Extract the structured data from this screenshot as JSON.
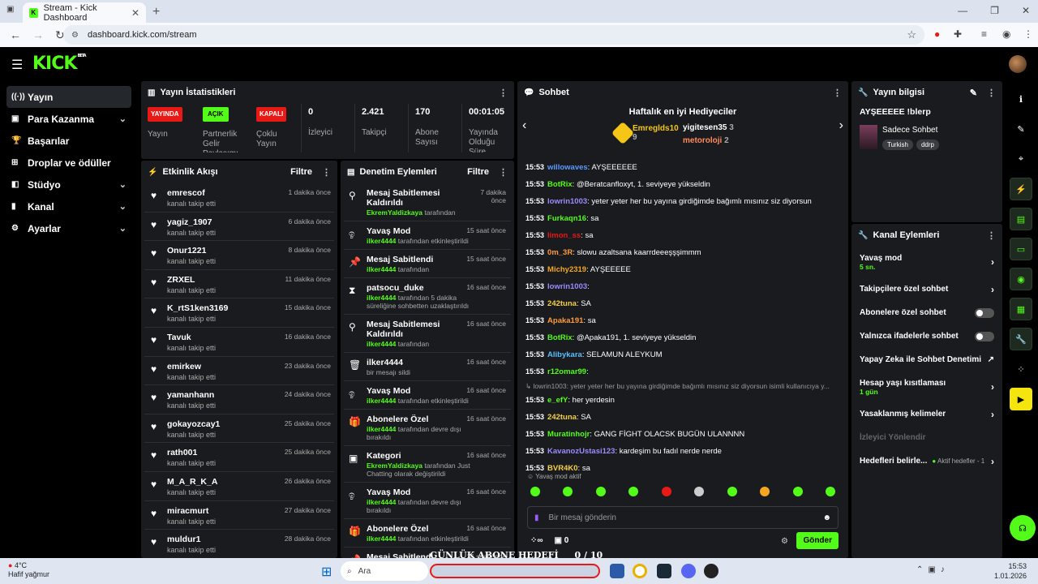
{
  "browser": {
    "tab_title": "Stream - Kick Dashboard",
    "url": "dashboard.kick.com/stream"
  },
  "brand": {
    "logo": "KICK",
    "beta": "BETA",
    "accent": "#53fc18"
  },
  "sidebar": {
    "items": [
      {
        "label": "Yayın",
        "icon": "broadcast-icon"
      },
      {
        "label": "Para Kazanma",
        "icon": "money-icon"
      },
      {
        "label": "Başarılar",
        "icon": "trophy-icon"
      },
      {
        "label": "Droplar ve ödüller",
        "icon": "gift-icon"
      },
      {
        "label": "Stüdyo",
        "icon": "studio-icon"
      },
      {
        "label": "Kanal",
        "icon": "channel-icon"
      },
      {
        "label": "Ayarlar",
        "icon": "gear-icon"
      }
    ]
  },
  "stats": {
    "title": "Yayın İstatistikleri",
    "live_badge": "YAYINDA",
    "live_label": "Yayın",
    "partner_badge": "AÇIK",
    "partner_label": "Partnerlik Gelir Paylaşımı",
    "multi_badge": "KAPALI",
    "multi_label": "Çoklu Yayın",
    "viewers_value": "0",
    "viewers_label": "İzleyici",
    "followers_value": "2.421",
    "followers_label": "Takipçi",
    "subs_value": "170",
    "subs_label": "Abone Sayısı",
    "uptime_value": "00:01:05",
    "uptime_label": "Yayında Olduğu Süre"
  },
  "activity": {
    "title": "Etkinlik Akışı",
    "filter": "Filtre",
    "rows": [
      {
        "name": "emrescof",
        "sub": "kanalı takip etti",
        "time": "1 dakika önce"
      },
      {
        "name": "yagiz_1907",
        "sub": "kanalı takip etti",
        "time": "6 dakika önce"
      },
      {
        "name": "Onur1221",
        "sub": "kanalı takip etti",
        "time": "8 dakika önce"
      },
      {
        "name": "ZRXEL",
        "sub": "kanalı takip etti",
        "time": "11 dakika önce"
      },
      {
        "name": "K_rtS1ken3169",
        "sub": "kanalı takip etti",
        "time": "15 dakika önce"
      },
      {
        "name": "Tavuk",
        "sub": "kanalı takip etti",
        "time": "16 dakika önce"
      },
      {
        "name": "emirkew",
        "sub": "kanalı takip etti",
        "time": "23 dakika önce"
      },
      {
        "name": "yamanhann",
        "sub": "kanalı takip etti",
        "time": "24 dakika önce"
      },
      {
        "name": "gokayozcay1",
        "sub": "kanalı takip etti",
        "time": "25 dakika önce"
      },
      {
        "name": "rath001",
        "sub": "kanalı takip etti",
        "time": "25 dakika önce"
      },
      {
        "name": "M_A_R_K_A",
        "sub": "kanalı takip etti",
        "time": "26 dakika önce"
      },
      {
        "name": "miracmurt",
        "sub": "kanalı takip etti",
        "time": "27 dakika önce"
      },
      {
        "name": "muldur1",
        "sub": "kanalı takip etti",
        "time": "28 dakika önce"
      }
    ]
  },
  "moderation": {
    "title": "Denetim Eylemleri",
    "filter": "Filtre",
    "rows": [
      {
        "name": "Mesaj Sabitlemesi Kaldırıldı",
        "user": "EkremYaldizkaya",
        "sub": " tarafından",
        "time": "7 dakika önce",
        "icon": "unpin-icon"
      },
      {
        "name": "Yavaş Mod",
        "user": "ilker4444",
        "sub": " tarafından etkinleştirildi",
        "time": "15 saat önce",
        "icon": "snail-icon"
      },
      {
        "name": "Mesaj Sabitlendi",
        "user": "ilker4444",
        "sub": " tarafından",
        "time": "15 saat önce",
        "icon": "pin-icon"
      },
      {
        "name": "patsocu_duke",
        "user": "ilker4444",
        "sub": " tarafından 5 dakika süreliğine sohbetten uzaklaştırıldı",
        "time": "16 saat önce",
        "icon": "hourglass-icon"
      },
      {
        "name": "Mesaj Sabitlemesi Kaldırıldı",
        "user": "ilker4444",
        "sub": " tarafından",
        "time": "16 saat önce",
        "icon": "unpin-icon"
      },
      {
        "name": "ilker4444",
        "user": "",
        "sub": "bir mesajı sildi",
        "time": "16 saat önce",
        "icon": "trash-icon"
      },
      {
        "name": "Yavaş Mod",
        "user": "ilker4444",
        "sub": " tarafından etkinleştirildi",
        "time": "16 saat önce",
        "icon": "snail-icon"
      },
      {
        "name": "Abonelere Özel",
        "user": "ilker4444",
        "sub": " tarafından devre dışı bırakıldı",
        "time": "16 saat önce",
        "icon": "gift-icon"
      },
      {
        "name": "Kategori",
        "user": "EkremYaldizkaya",
        "sub": " tarafından Just Chatting olarak değiştirildi",
        "time": "16 saat önce",
        "icon": "category-icon"
      },
      {
        "name": "Yavaş Mod",
        "user": "ilker4444",
        "sub": " tarafından devre dışı bırakıldı",
        "time": "16 saat önce",
        "icon": "snail-icon"
      },
      {
        "name": "Abonelere Özel",
        "user": "ilker4444",
        "sub": " tarafından etkinleştirildi",
        "time": "16 saat önce",
        "icon": "gift-icon"
      },
      {
        "name": "Mesaj Sabitlendi",
        "user": "",
        "sub": "",
        "time": "16 saat önce",
        "icon": "pin-icon"
      }
    ]
  },
  "chat": {
    "title": "Sohbet",
    "gifters_title": "Haftalık en iyi Hediyeciler",
    "gifter1": "Emreglds10",
    "gifter1_count": "9",
    "gifter2": "yigitesen35",
    "gifter2_count": "3",
    "gifter3": "metoroloji",
    "gifter3_count": "2",
    "messages": [
      {
        "time": "15:53",
        "user": "willowaves",
        "color": "#5b9bff",
        "text": "AYŞEEEEEE"
      },
      {
        "time": "15:53",
        "user": "BotRix",
        "color": "#53fc18",
        "text": "@Beratcanfloxyt, 1. seviyeye yükseldin"
      },
      {
        "time": "15:53",
        "user": "lowrin1003",
        "color": "#9b8cff",
        "text": "yeter yeter her bu yayına girdiğimde bağımlı mısınız siz diyorsun"
      },
      {
        "time": "15:53",
        "user": "Furkaqn16",
        "color": "#53fc18",
        "text": "sa"
      },
      {
        "time": "15:53",
        "user": "limon_ss",
        "color": "#e91916",
        "text": "sa"
      },
      {
        "time": "15:53",
        "user": "0m_3R",
        "color": "#ff9b3b",
        "text": "slowu azaltsana kaarrdeeeşşşimmm"
      },
      {
        "time": "15:53",
        "user": "Michy2319",
        "color": "#f5a623",
        "text": "AYŞEEEEE"
      },
      {
        "time": "15:53",
        "user": "lowrin1003",
        "color": "#9b8cff",
        "text": ""
      },
      {
        "time": "15:53",
        "user": "242tuna",
        "color": "#f5d142",
        "text": "SA"
      },
      {
        "time": "15:53",
        "user": "Apaka191",
        "color": "#ff9b3b",
        "text": "sa"
      },
      {
        "time": "15:53",
        "user": "BotRix",
        "color": "#53fc18",
        "text": "@Apaka191, 1. seviyeye yükseldin"
      },
      {
        "time": "15:53",
        "user": "Alibykara",
        "color": "#5bc0ff",
        "text": "SELAMUN ALEYKUM"
      },
      {
        "time": "15:53",
        "user": "r12omar99",
        "color": "#53fc18",
        "text": ""
      },
      {
        "time": "",
        "user": "",
        "color": "#999",
        "text": "↳ lowrin1003: yeter yeter her bu yayına girdiğimde bağımlı mısınız siz diyorsun isimli kullanıcıya y..."
      },
      {
        "time": "15:53",
        "user": "e_efY",
        "color": "#53fc18",
        "text": "her yerdesin"
      },
      {
        "time": "15:53",
        "user": "242tuna",
        "color": "#f5d142",
        "text": "SA"
      },
      {
        "time": "15:53",
        "user": "Muratinhojr",
        "color": "#53fc18",
        "text": "GANG FİGHT OLACSK BUGÜN ULANNNN"
      },
      {
        "time": "15:53",
        "user": "KavanozUstasi123",
        "color": "#9b8cff",
        "text": "kardeşim bu fadıl nerde nerde"
      },
      {
        "time": "15:53",
        "user": "BVR4K0",
        "color": "#f5d142",
        "text": "sa"
      }
    ],
    "slow_mode": "Yavaş mod aktif",
    "input_placeholder": "Bir mesaj gönderin",
    "counter": "0",
    "send": "Gönder"
  },
  "stream_info": {
    "title": "Yayın bilgisi",
    "stream_title": "AYŞEEEEE !blerp",
    "category": "Sadece Sohbet",
    "tags": [
      "Turkish",
      "ddrp"
    ]
  },
  "channel_actions": {
    "title": "Kanal Eylemleri",
    "slow": "Yavaş mod",
    "slow_sub": "5 sn.",
    "followers": "Takipçilere özel sohbet",
    "subs": "Abonelere özel sohbet",
    "emotes": "Yalnızca ifadelerle sohbet",
    "ai": "Yapay Zeka ile Sohbet Denetimi",
    "age": "Hesap yaşı kısıtlaması",
    "age_sub": "1 gün",
    "banned": "Yasaklanmış kelimeler",
    "host": "İzleyici Yönlendir",
    "goals": "Hedefleri belirle...",
    "goals_status": "Aktif hedefler - 1"
  },
  "overlay": {
    "banner": "GÜNLÜK ABONE HEDEFİ",
    "progress": "0 / 10"
  },
  "taskbar": {
    "weather_temp": "4°C",
    "weather_desc": "Hafif yağmur",
    "search": "Ara",
    "time": "15:53",
    "date": "1.01.2026"
  }
}
